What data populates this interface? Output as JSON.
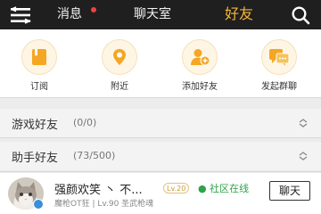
{
  "header": {
    "tabs": [
      {
        "label": "消息",
        "active": false,
        "has_badge": true
      },
      {
        "label": "聊天室",
        "active": false
      },
      {
        "label": "好友",
        "active": true
      }
    ],
    "accent_color": "#f5b53a",
    "badge_color": "#f44040",
    "icons": {
      "menu": "menu-icon",
      "search": "search-icon"
    }
  },
  "actions": [
    {
      "label": "订阅",
      "icon": "subscribe-icon"
    },
    {
      "label": "附近",
      "icon": "location-icon"
    },
    {
      "label": "添加好友",
      "icon": "add-friend-icon"
    },
    {
      "label": "发起群聊",
      "icon": "group-chat-icon"
    }
  ],
  "groups": [
    {
      "name": "游戏好友",
      "count": "(0/0)"
    },
    {
      "name": "助手好友",
      "count": "(73/500)"
    }
  ],
  "friend": {
    "name": "强颜欢笑 丶 不...",
    "level_badge": "Lv.20",
    "status": "● 社区在线",
    "status_color": "#2fa24a",
    "subtitle": "魔枪OT狂 | Lv.90 圣武枪魂",
    "chat_label": "聊天"
  }
}
